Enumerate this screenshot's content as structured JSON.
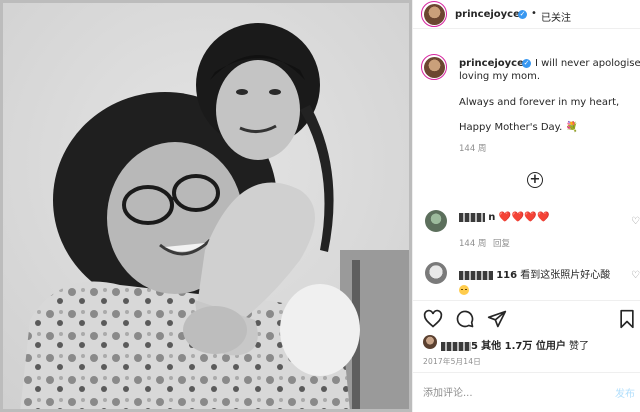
{
  "post": {
    "username": "princejoyce",
    "follow_status": "已关注",
    "separator": "•"
  },
  "caption": {
    "username": "princejoyce",
    "line1": "I will never apologise for",
    "line2": "loving my mom.",
    "line3": "Always and forever in my heart,",
    "line4": "Happy Mother's Day.",
    "time": "144 周"
  },
  "comments": [
    {
      "name_suffix": "n",
      "text": "❤️❤️❤️❤️",
      "time": "144 周",
      "reply": "回复"
    },
    {
      "name_suffix": "116",
      "text": "看到这张照片好心酸"
    }
  ],
  "likes": {
    "name_suffix": "5",
    "text": "其他 1.7万 位用户",
    "action": "赞了"
  },
  "date": "2017年5月14日",
  "add_comment": {
    "placeholder": "添加评论...",
    "post_label": "发布"
  },
  "icons": {
    "verified": "verified-badge-icon",
    "heart": "heart-icon",
    "comment": "comment-icon",
    "share": "share-icon",
    "save": "bookmark-icon",
    "more": "plus-circle-icon"
  },
  "colors": {
    "verified": "#3897f0",
    "heart": "#ed4956",
    "text": "#262626",
    "muted": "#8e8e8e",
    "post_button": "#b2dffc"
  }
}
